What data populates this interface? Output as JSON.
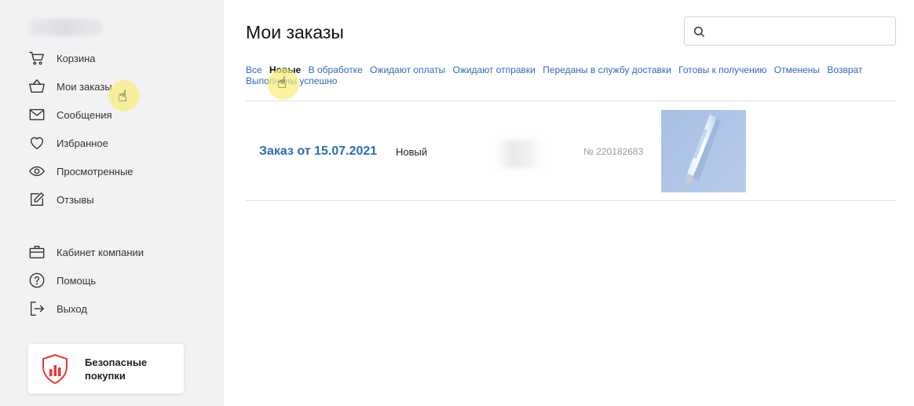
{
  "sidebar": {
    "items": [
      {
        "label": "Корзина",
        "icon": "cart-icon"
      },
      {
        "label": "Мои заказы",
        "icon": "basket-icon"
      },
      {
        "label": "Сообщения",
        "icon": "envelope-icon"
      },
      {
        "label": "Избранное",
        "icon": "heart-icon"
      },
      {
        "label": "Просмотренные",
        "icon": "eye-icon"
      },
      {
        "label": "Отзывы",
        "icon": "edit-icon"
      }
    ],
    "secondary": [
      {
        "label": "Кабинет компании",
        "icon": "briefcase-icon"
      },
      {
        "label": "Помощь",
        "icon": "help-icon"
      },
      {
        "label": "Выход",
        "icon": "logout-icon"
      }
    ],
    "safe_purchases": {
      "label": "Безопасные покупки",
      "icon": "shield-chart-icon",
      "color": "#e53935"
    }
  },
  "main": {
    "title": "Мои заказы",
    "search": {
      "value": "",
      "placeholder": ""
    },
    "filters": [
      {
        "label": "Все",
        "active": false
      },
      {
        "label": "Новые",
        "active": true
      },
      {
        "label": "В обработке",
        "active": false
      },
      {
        "label": "Ожидают оплаты",
        "active": false
      },
      {
        "label": "Ожидают отправки",
        "active": false
      },
      {
        "label": "Переданы в службу доставки",
        "active": false
      },
      {
        "label": "Готовы к получению",
        "active": false
      },
      {
        "label": "Отменены",
        "active": false
      },
      {
        "label": "Возврат",
        "active": false
      },
      {
        "label": "Выполнены успешно",
        "active": false
      }
    ],
    "orders": [
      {
        "title": "Заказ от 15.07.2021",
        "status": "Новый",
        "number": "№ 220182683",
        "image": "product-tube-image"
      }
    ]
  },
  "colors": {
    "link": "#2f6bb3",
    "sidebar_bg": "#f2f2f4",
    "accent_red": "#e53935",
    "cursor_highlight": "#faec78"
  }
}
